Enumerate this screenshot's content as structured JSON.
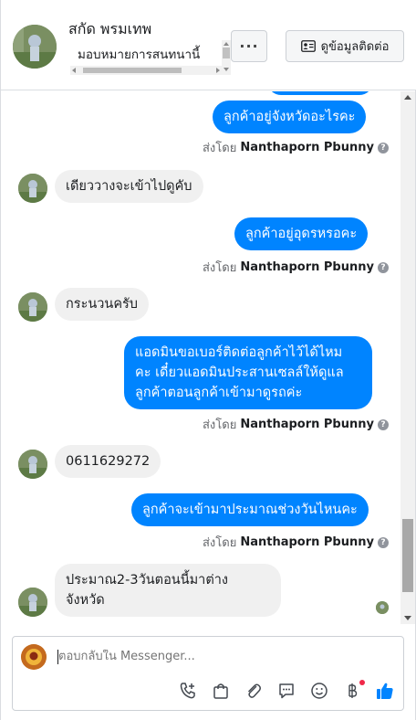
{
  "header": {
    "contact_name": "สกัด พรมเทพ",
    "assign_label": "มอบหมายการสนทนานี้",
    "more_label": "···",
    "contact_info_label": "ดูข้อมูลติดต่อ"
  },
  "messages": [
    {
      "from": "page",
      "text": "ลูกค้าอยู่จังหวัดอะไรคะ"
    },
    {
      "from": "user",
      "text": "เดียววางจะเข้าไปดูคับ"
    },
    {
      "from": "page",
      "text": "ลูกค้าอยู่อุดรหรอคะ"
    },
    {
      "from": "user",
      "text": "กระนวนครับ"
    },
    {
      "from": "page",
      "text_lines": [
        "แอดมินขอเบอร์ติดต่อลูกค้าไว้ได้ไหม",
        "คะ เดี๋ยวแอดมินประสานเซลล์ให้ดูแล",
        "ลูกค้าตอนลูกค้าเข้ามาดูรถค่ะ"
      ]
    },
    {
      "from": "user",
      "text": "0611629272"
    },
    {
      "from": "page",
      "text": "ลูกค้าจะเข้ามาประมาณช่วงวันไหนคะ"
    },
    {
      "from": "user",
      "text_lines": [
        "ประมาณ2-3วันตอนนี้มาต่าง",
        "จังหวัด"
      ]
    }
  ],
  "sent_by": {
    "prefix": "ส่งโดย",
    "agent": "Nanthaporn Pbunny",
    "help": "?"
  },
  "composer": {
    "placeholder": "ตอบกลับใน Messenger..."
  },
  "icons": {
    "more": "ellipsis-icon",
    "contact": "id-card-icon",
    "call": "phone-plus-icon",
    "shop": "shopping-bag-icon",
    "attach": "paperclip-icon",
    "reply": "saved-reply-icon",
    "emoji": "smile-icon",
    "payment": "baht-icon",
    "like": "thumbs-up-icon"
  },
  "colors": {
    "outgoing_bubble": "#0084ff",
    "incoming_bubble": "#f0f0f0",
    "like": "#0084ff"
  }
}
